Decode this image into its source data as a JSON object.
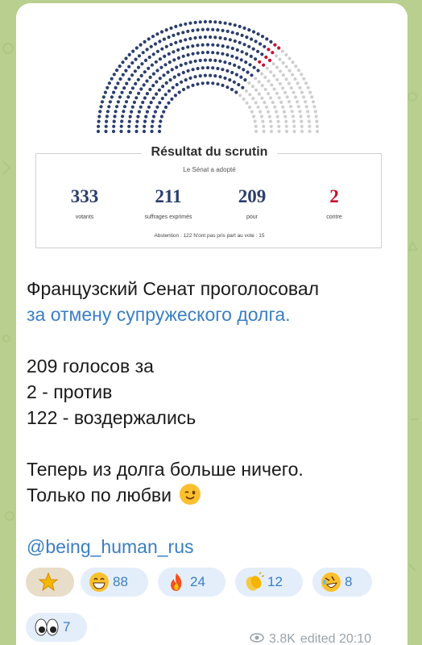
{
  "card": {
    "title": "Résultat du scrutin",
    "adopted": "Le Sénat a adopté",
    "stats": [
      {
        "value": "333",
        "label": "votants"
      },
      {
        "value": "211",
        "label": "suffrages exprimés"
      },
      {
        "value": "209",
        "label": "pour"
      },
      {
        "value": "2",
        "label": "contre"
      }
    ],
    "abstention": "Abstention : 122   N'ont pas pris part au vote : 15",
    "colors": {
      "blue": "#2b3d6e",
      "red": "#c8102e",
      "grey": "#cfcfcf"
    }
  },
  "message": {
    "line1": "Французский Сенат проголосовал",
    "line2": "за отмену супружеского долга.",
    "line3": "209 голосов за",
    "line4": "2 - против",
    "line5": "122 - воздержались",
    "line6": "Теперь из долга больше ничего.",
    "line7": "Только по любви",
    "line7_emoji": "winking-face-emoji",
    "mention": "@being_human_rus"
  },
  "reactions": [
    {
      "icon": "star-icon",
      "count": ""
    },
    {
      "icon": "grinning-face-icon",
      "count": "88"
    },
    {
      "icon": "fire-icon",
      "count": "24"
    },
    {
      "icon": "clapping-hands-icon",
      "count": "12"
    },
    {
      "icon": "rolling-laughing-icon",
      "count": "8"
    },
    {
      "icon": "eyes-icon",
      "count": "7"
    }
  ],
  "footer": {
    "views": "3.8K",
    "edited": "edited 20:10"
  }
}
